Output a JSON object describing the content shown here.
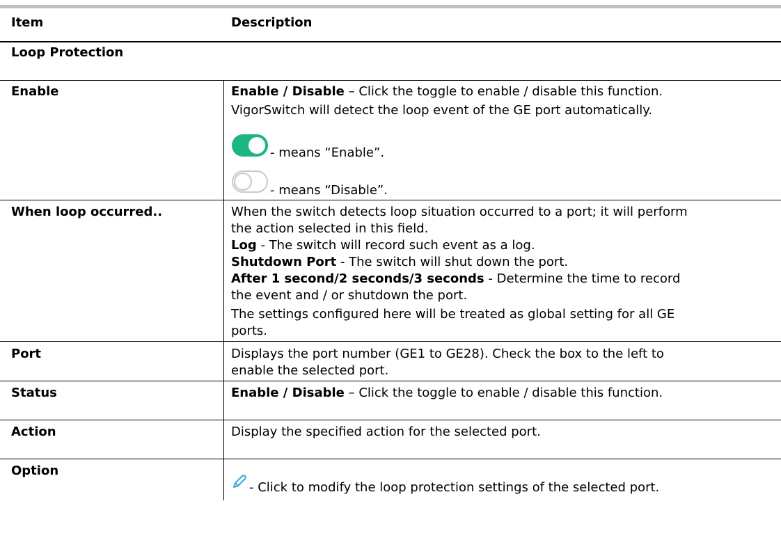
{
  "table": {
    "headers": {
      "item": "Item",
      "description": "Description"
    },
    "section_title": "Loop Protection",
    "rows": {
      "enable": {
        "item": "Enable",
        "line1_bold": "Enable / Disable",
        "line1_rest": " – Click the toggle to enable / disable this function.",
        "line2": "VigorSwitch will detect the loop event of the GE port automatically.",
        "enable_text": "- means “Enable”.",
        "disable_text": "- means “Disable”."
      },
      "loop": {
        "item": "When loop occurred..",
        "line1": "When the switch detects loop situation occurred to a port; it will perform",
        "line2": "the action selected in this field.",
        "log_bold": "Log",
        "log_rest": " - The switch will record such event as a log.",
        "shutdown_bold": "Shutdown Port",
        "shutdown_rest": " - The switch will shut down the port.",
        "after_bold": "After 1 second/2 seconds/3 seconds",
        "after_rest": " - Determine the time to record",
        "after_line2": "the event and / or shutdown the port.",
        "global_line1": "The settings configured here will be treated as global setting for all GE",
        "global_line2": "ports."
      },
      "port": {
        "item": "Port",
        "line1": "Displays the port number (GE1 to GE28). Check the box to the left to",
        "line2": "enable the selected port."
      },
      "status": {
        "item": "Status",
        "bold": "Enable / Disable",
        "rest": " – Click the toggle to enable / disable this function."
      },
      "action": {
        "item": "Action",
        "text": "Display the specified action for the selected port."
      },
      "option": {
        "item": "Option",
        "text": "- Click to modify the loop protection settings of the selected port."
      }
    }
  },
  "icons": {
    "toggle_on": "toggle-on-icon",
    "toggle_off": "toggle-off-icon",
    "edit": "pencil-icon"
  },
  "colors": {
    "toggle_on": "#1db582",
    "toggle_off_border": "#c8c8c8",
    "pencil": "#3aa3e0"
  }
}
